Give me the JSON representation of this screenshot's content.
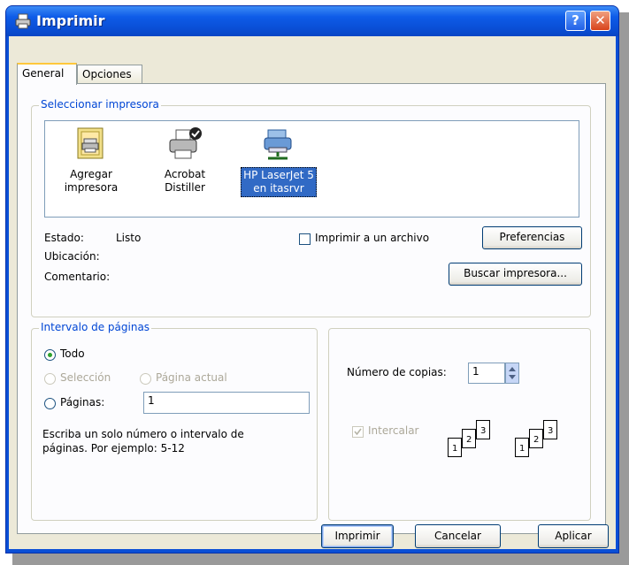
{
  "window": {
    "title": "Imprimir",
    "help_label": "?",
    "close_label": "✕"
  },
  "tabs": [
    {
      "label": "General"
    },
    {
      "label": "Opciones"
    }
  ],
  "select_printer": {
    "legend": "Seleccionar impresora",
    "printers": [
      {
        "line1": "Agregar",
        "line2": "impresora",
        "icon": "add-printer-icon"
      },
      {
        "line1": "Acrobat",
        "line2": "Distiller",
        "icon": "printer-default-icon"
      },
      {
        "line1": "HP LaserJet 5",
        "line2": "en itasrvr",
        "icon": "network-printer-icon",
        "selected": true
      }
    ],
    "status_label": "Estado:",
    "status_value": "Listo",
    "location_label": "Ubicación:",
    "location_value": "",
    "comment_label": "Comentario:",
    "comment_value": "",
    "print_to_file": {
      "label": "Imprimir a un archivo",
      "checked": false
    },
    "preferences_label": "Preferencias",
    "find_printer_label": "Buscar impresora..."
  },
  "page_range": {
    "legend": "Intervalo de páginas",
    "all_label": "Todo",
    "selection_label": "Selección",
    "current_page_label": "Página actual",
    "pages_label": "Páginas:",
    "pages_value": "1",
    "hint_line1": "Escriba un solo número o intervalo de",
    "hint_line2": "páginas. Por ejemplo: 5-12"
  },
  "copies": {
    "label": "Número de copias:",
    "value": "1",
    "collate_label": "Intercalar",
    "collate_checked": true
  },
  "footer": {
    "print_label": "Imprimir",
    "cancel_label": "Cancelar",
    "apply_label": "Aplicar"
  },
  "colors": {
    "titlebar": "#0a4fd6",
    "selection": "#316ac5",
    "groupbox_label": "#0046d5",
    "dialog_bg": "#ece9d8"
  }
}
